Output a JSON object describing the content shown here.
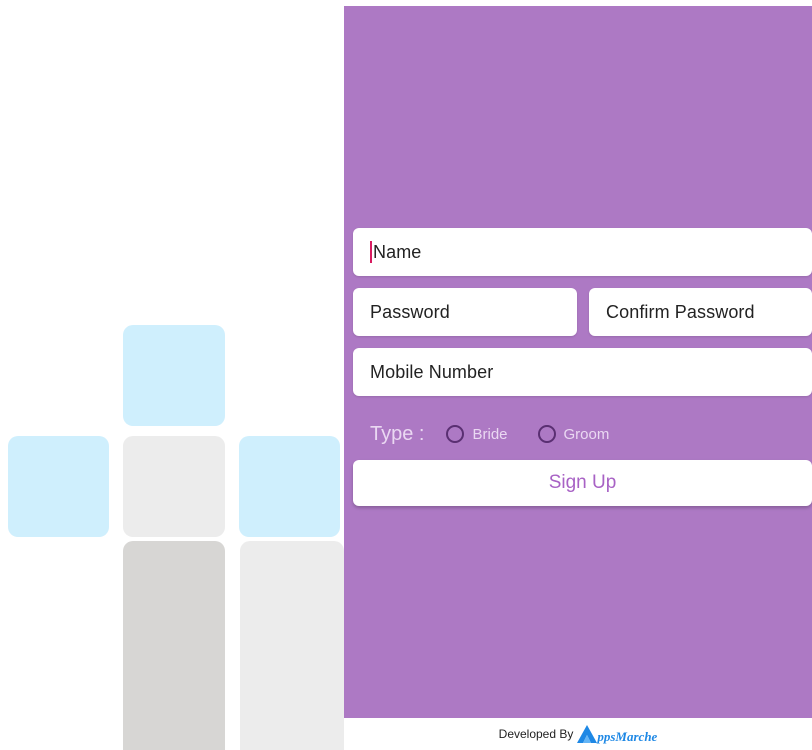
{
  "form": {
    "name_placeholder": "Name",
    "password_placeholder": "Password",
    "confirm_password_placeholder": "Confirm Password",
    "mobile_placeholder": "Mobile Number",
    "type_label": "Type :",
    "type_options": [
      "Bride",
      "Groom"
    ],
    "signup_label": "Sign Up"
  },
  "footer": {
    "developed_by": "Developed By",
    "brand_rest": "ppsMarche",
    "brand_icon": "appsmarche-logo-icon"
  },
  "colors": {
    "panel": "#ad79c4",
    "accent": "#a862c5",
    "tile_blue": "#cfeffd",
    "tile_grey": "#ececec",
    "brand_blue": "#1e88e5"
  }
}
